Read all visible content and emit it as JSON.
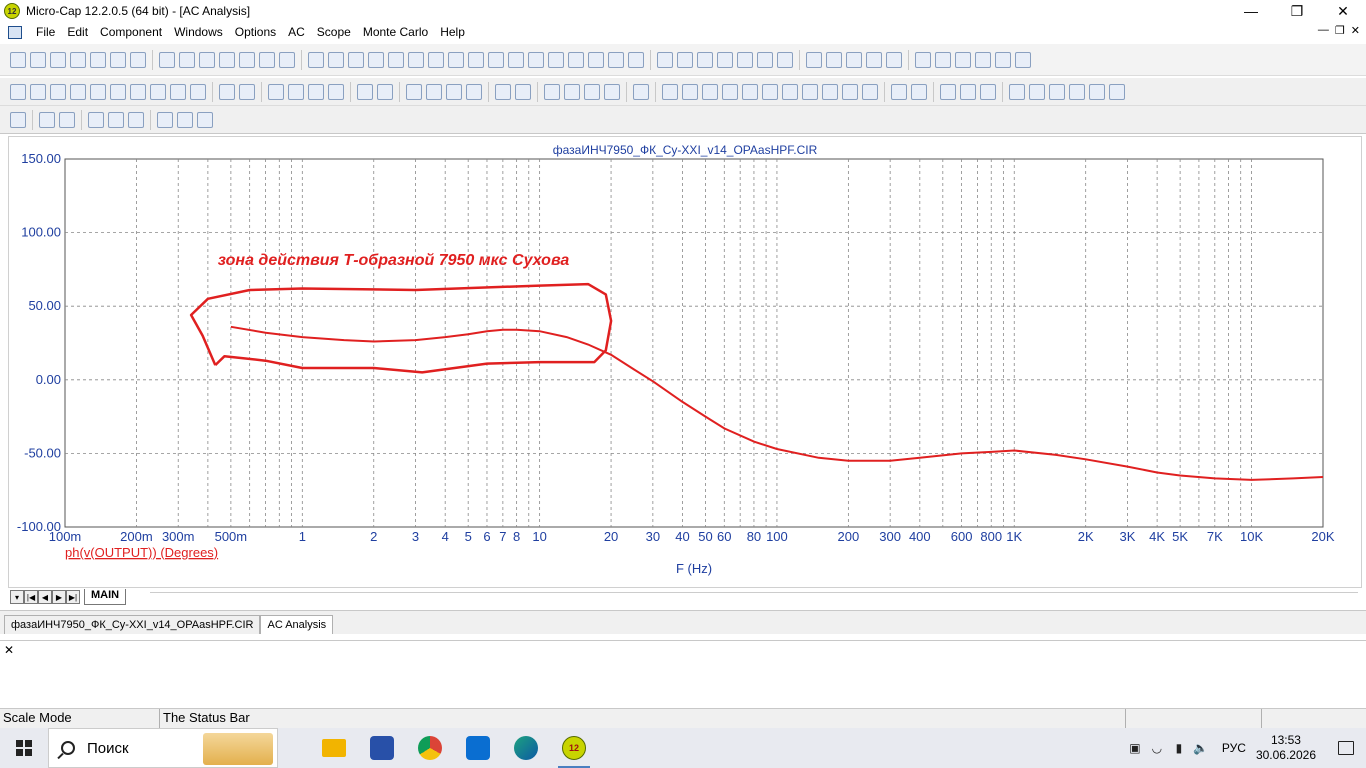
{
  "window": {
    "title": "Micro-Cap 12.2.0.5 (64 bit) - [AC Analysis]",
    "app_icon_text": "12"
  },
  "menu": [
    "File",
    "Edit",
    "Component",
    "Windows",
    "Options",
    "AC",
    "Scope",
    "Monte Carlo",
    "Help"
  ],
  "plot": {
    "title": "фазаИНЧ7950_ФК_Су-XXI_v14_OPAasHPF.CIR",
    "y_label": "ph(v(OUTPUT)) (Degrees)",
    "x_label": "F (Hz)",
    "annotation": "зона действия Т-образной 7950 мкс Сухова",
    "trace_color": "#e02020",
    "axis_color": "#1f3fa0"
  },
  "chart_data": {
    "type": "line",
    "xscale": "log",
    "xlim": [
      0.1,
      20000
    ],
    "ylim": [
      -100,
      150
    ],
    "yticks": [
      "150.00",
      "100.00",
      "50.00",
      "0.00",
      "-50.00",
      "-100.00"
    ],
    "xticks": [
      {
        "v": 0.1,
        "t": "100m"
      },
      {
        "v": 0.2,
        "t": "200m"
      },
      {
        "v": 0.3,
        "t": "300m"
      },
      {
        "v": 0.5,
        "t": "500m"
      },
      {
        "v": 1,
        "t": "1"
      },
      {
        "v": 2,
        "t": "2"
      },
      {
        "v": 3,
        "t": "3"
      },
      {
        "v": 4,
        "t": "4"
      },
      {
        "v": 5,
        "t": "5"
      },
      {
        "v": 6,
        "t": "6"
      },
      {
        "v": 7,
        "t": "7"
      },
      {
        "v": 8,
        "t": "8"
      },
      {
        "v": 10,
        "t": "10"
      },
      {
        "v": 20,
        "t": "20"
      },
      {
        "v": 30,
        "t": "30"
      },
      {
        "v": 40,
        "t": "40"
      },
      {
        "v": 50,
        "t": "50"
      },
      {
        "v": 60,
        "t": "60"
      },
      {
        "v": 80,
        "t": "80"
      },
      {
        "v": 100,
        "t": "100"
      },
      {
        "v": 200,
        "t": "200"
      },
      {
        "v": 300,
        "t": "300"
      },
      {
        "v": 400,
        "t": "400"
      },
      {
        "v": 600,
        "t": "600"
      },
      {
        "v": 800,
        "t": "800"
      },
      {
        "v": 1000,
        "t": "1K"
      },
      {
        "v": 2000,
        "t": "2K"
      },
      {
        "v": 3000,
        "t": "3K"
      },
      {
        "v": 4000,
        "t": "4K"
      },
      {
        "v": 5000,
        "t": "5K"
      },
      {
        "v": 7000,
        "t": "7K"
      },
      {
        "v": 10000,
        "t": "10K"
      },
      {
        "v": 20000,
        "t": "20K"
      }
    ],
    "series": [
      {
        "x": [
          0.5,
          0.7,
          1,
          1.5,
          2,
          3,
          4,
          5,
          6,
          7,
          8,
          10,
          13,
          16,
          20,
          25,
          30,
          40,
          50,
          60,
          80,
          100,
          150,
          200,
          300,
          400,
          600,
          800,
          1000,
          1500,
          2000,
          3000,
          4000,
          5000,
          7000,
          10000,
          15000,
          20000
        ],
        "y": [
          36,
          32,
          29,
          27,
          26,
          27,
          29,
          31,
          33,
          34,
          34,
          33,
          29,
          24,
          17,
          7,
          -1,
          -15,
          -25,
          -33,
          -42,
          -47,
          -53,
          -55,
          -55,
          -53,
          -50,
          -49,
          -48,
          -51,
          -54,
          -59,
          -63,
          -65,
          -67,
          -68,
          -67,
          -66
        ]
      }
    ]
  },
  "sheet_tab": "MAIN",
  "doc_tabs": [
    "фазаИНЧ7950_ФК_Су-XXI_v14_OPAasHPF.CIR",
    "AC Analysis"
  ],
  "status": {
    "mode": "Scale Mode",
    "text": "The Status Bar"
  },
  "taskbar": {
    "search_placeholder": "Поиск",
    "lang": "РУС",
    "time": "13:53",
    "date": "30.06.2026",
    "apps": [
      {
        "name": "file-explorer",
        "color": "#f2b400"
      },
      {
        "name": "save-app",
        "color": "#2850a8"
      },
      {
        "name": "chrome",
        "color": "#db4437"
      },
      {
        "name": "store",
        "color": "#0a6ed1"
      },
      {
        "name": "edge",
        "color": "#1da27f"
      },
      {
        "name": "microcap",
        "color": "#c8d400"
      }
    ]
  }
}
